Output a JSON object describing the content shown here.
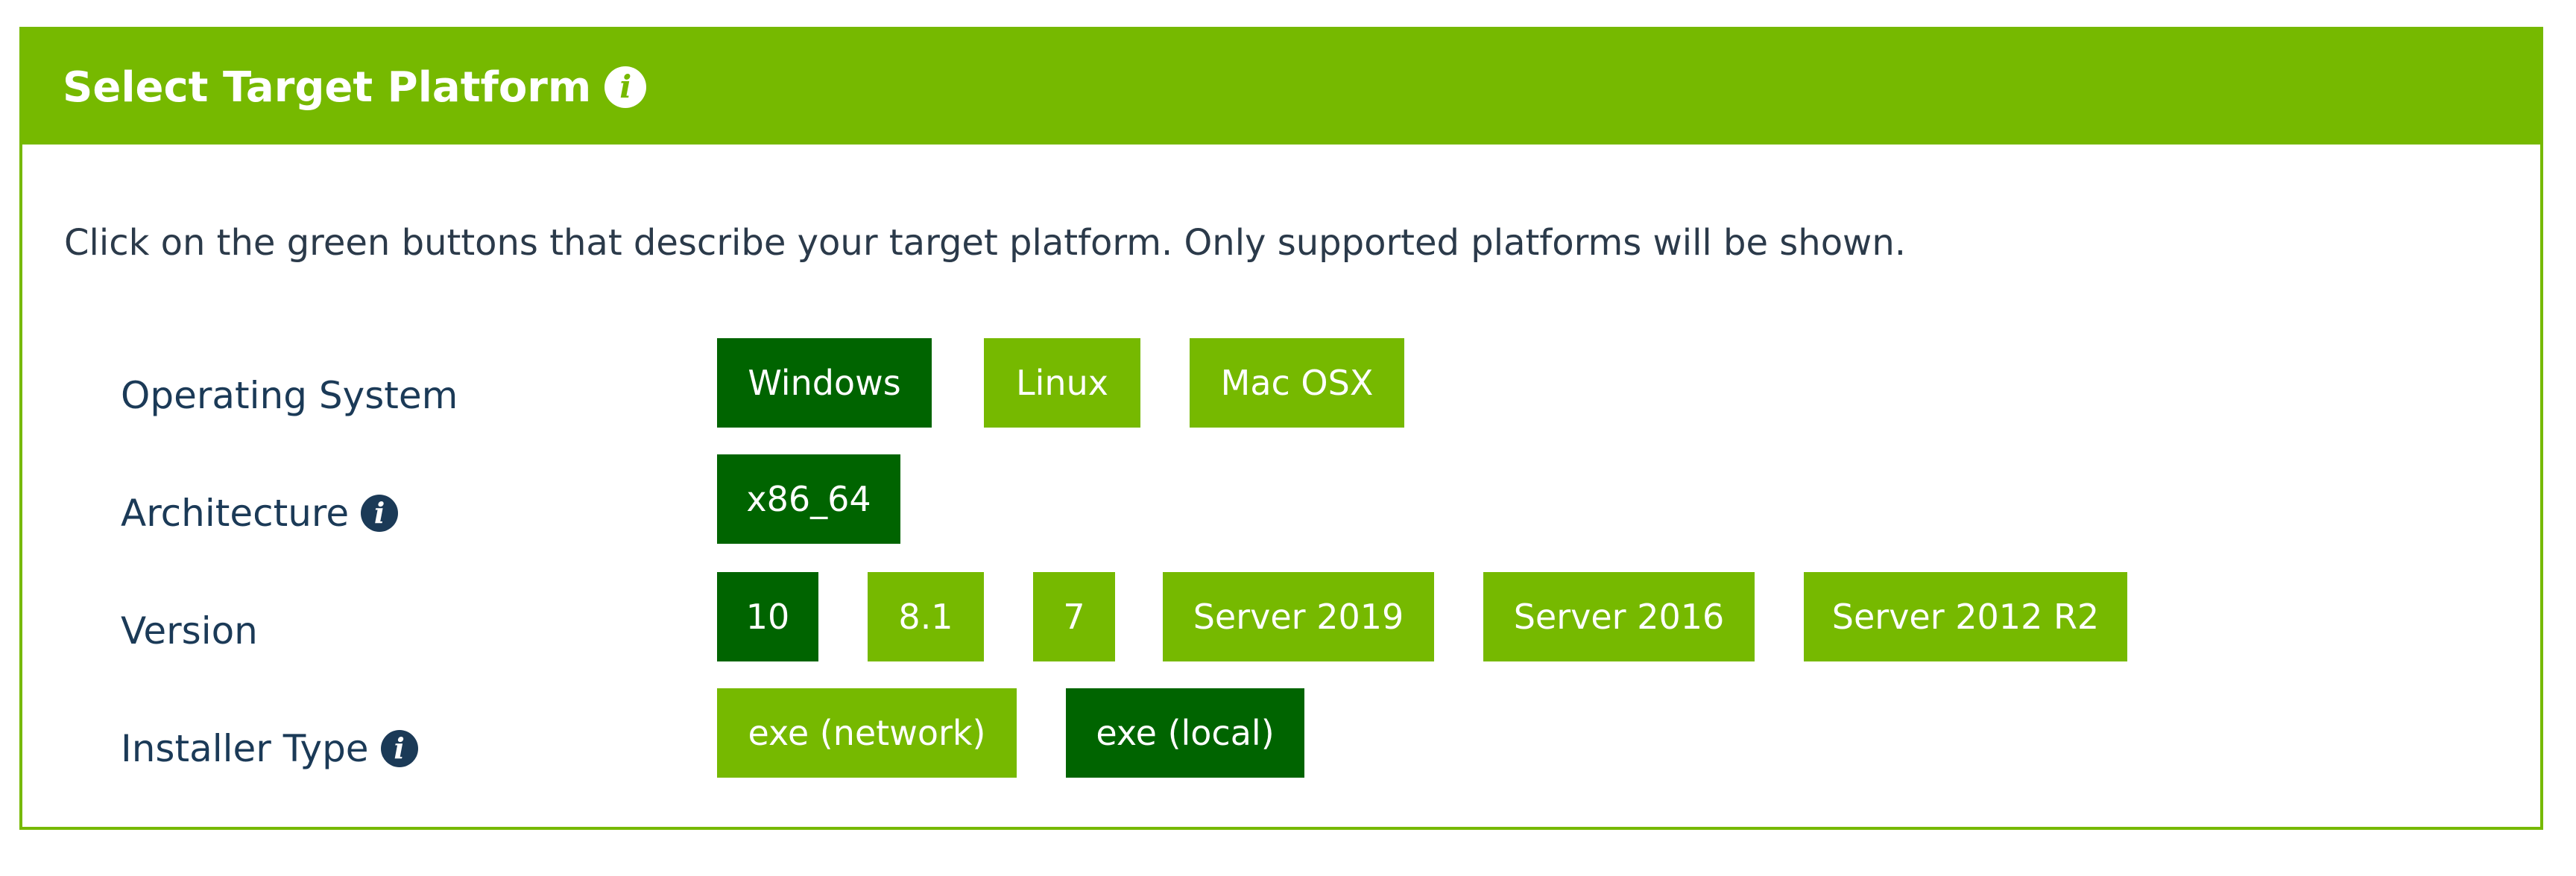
{
  "header": {
    "title": "Select Target Platform",
    "info_icon": "info-icon"
  },
  "description": "Click on the green buttons that describe your target platform. Only supported platforms will be shown.",
  "rows": [
    {
      "label": "Operating System",
      "has_info": false,
      "options": [
        {
          "label": "Windows",
          "selected": true
        },
        {
          "label": "Linux",
          "selected": false
        },
        {
          "label": "Mac OSX",
          "selected": false
        }
      ]
    },
    {
      "label": "Architecture",
      "has_info": true,
      "options": [
        {
          "label": "x86_64",
          "selected": true
        }
      ]
    },
    {
      "label": "Version",
      "has_info": false,
      "options": [
        {
          "label": "10",
          "selected": true
        },
        {
          "label": "8.1",
          "selected": false
        },
        {
          "label": "7",
          "selected": false
        },
        {
          "label": "Server 2019",
          "selected": false
        },
        {
          "label": "Server 2016",
          "selected": false
        },
        {
          "label": "Server 2012 R2",
          "selected": false
        }
      ]
    },
    {
      "label": "Installer Type",
      "has_info": true,
      "options": [
        {
          "label": "exe (network)",
          "selected": false
        },
        {
          "label": "exe (local)",
          "selected": true
        }
      ]
    }
  ],
  "colors": {
    "accent": "#76b900",
    "selected": "#006400",
    "label_text": "#1b3a57"
  }
}
